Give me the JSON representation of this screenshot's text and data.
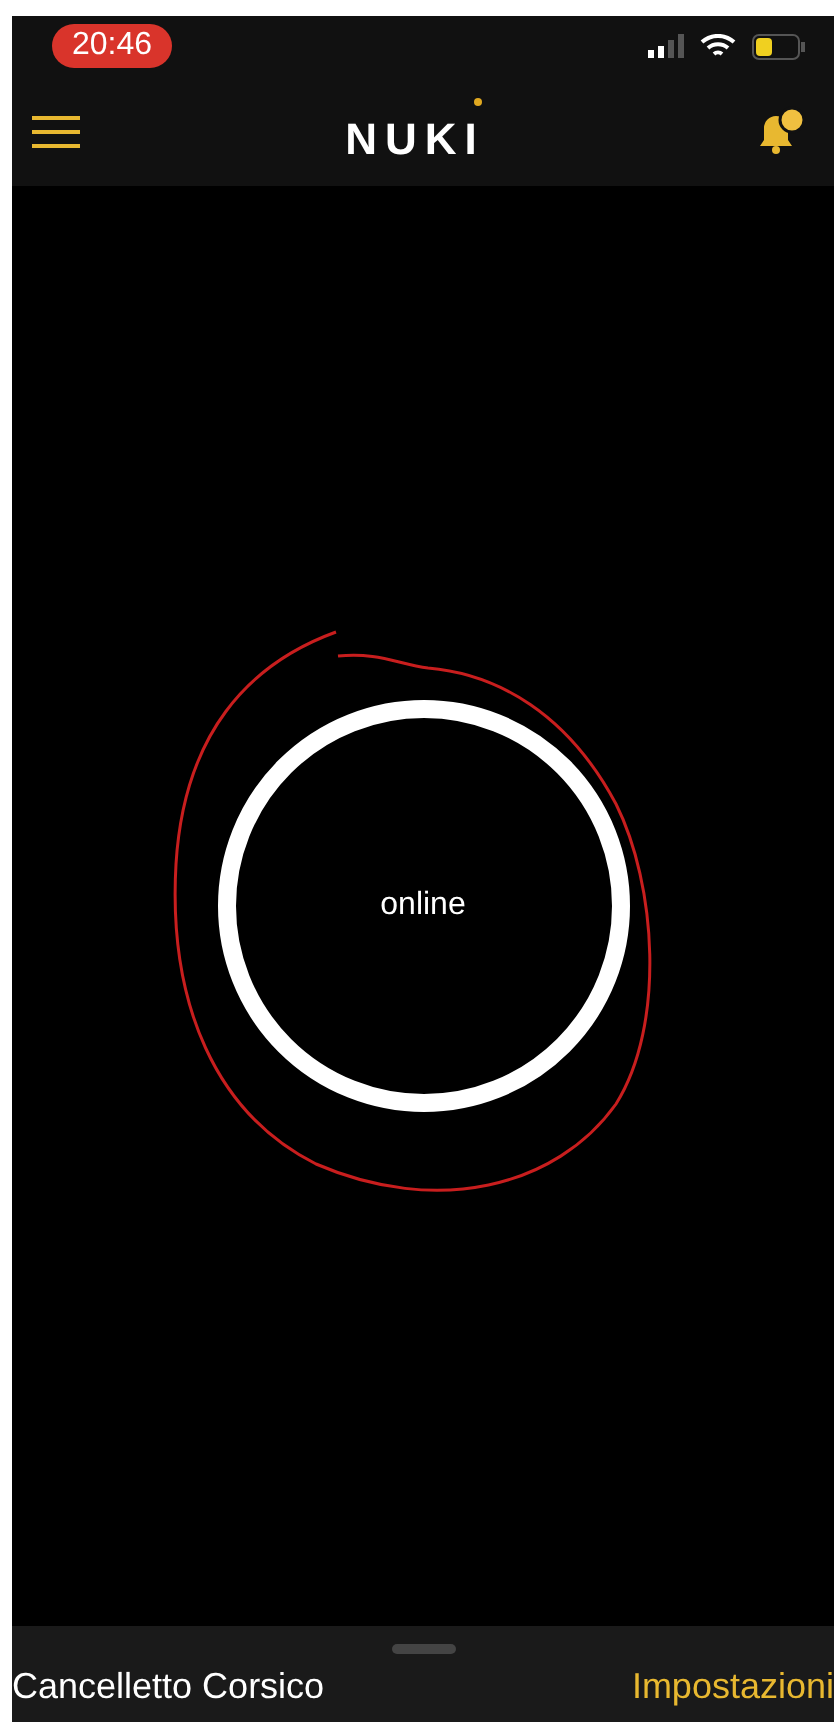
{
  "status_bar": {
    "time": "20:46"
  },
  "header": {
    "logo": "NUKI",
    "notification": true
  },
  "lock": {
    "status": "online"
  },
  "bottom_bar": {
    "device_name": "Cancelletto Corsico",
    "settings_link": "Impostazioni"
  }
}
